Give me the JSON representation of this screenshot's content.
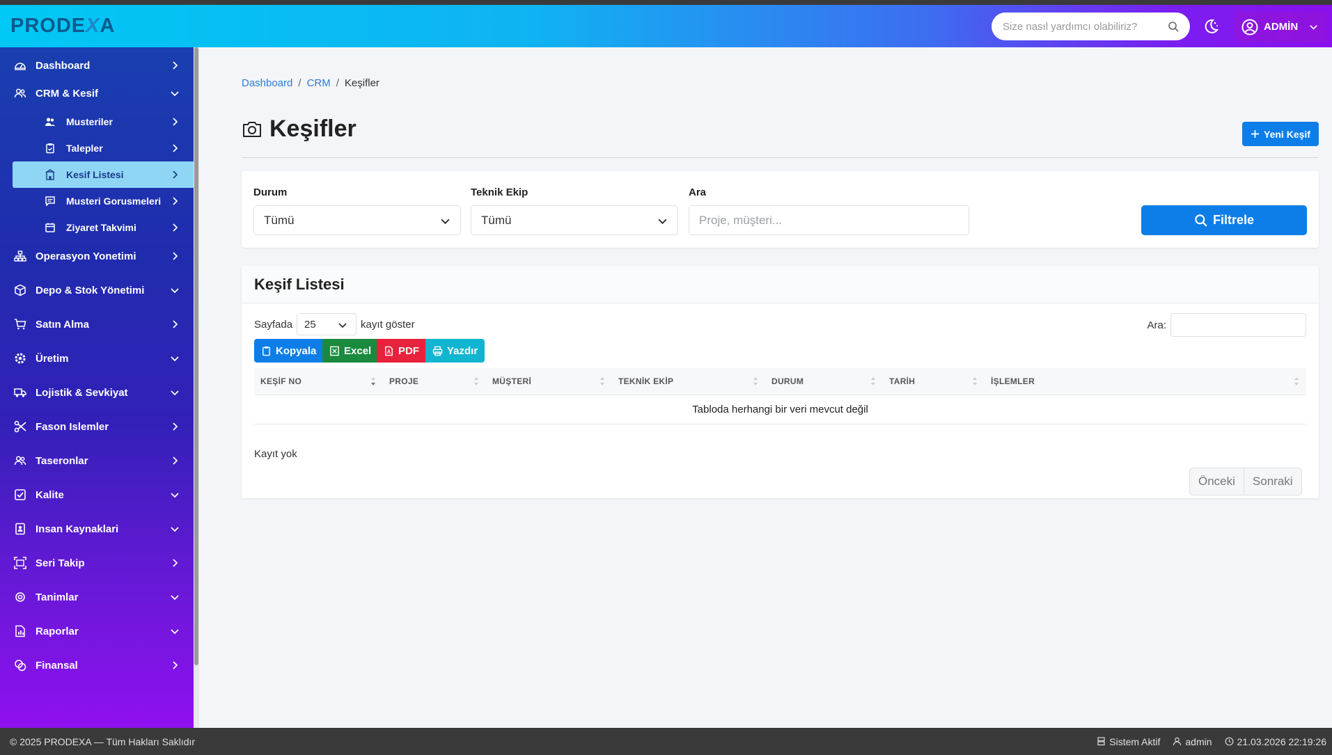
{
  "header": {
    "logo_pre": "PRODE",
    "logo_x": "X",
    "logo_post": "A",
    "search_placeholder": "Size nasıl yardımcı olabiliriz?",
    "user_label": "ADMİN"
  },
  "sidebar": {
    "items": [
      {
        "label": "Dashboard",
        "icon": "dashboard-icon"
      },
      {
        "label": "CRM & Kesif",
        "icon": "users-icon"
      },
      {
        "label": "Operasyon Yonetimi",
        "icon": "sitemap-icon"
      },
      {
        "label": "Depo & Stok Yönetimi",
        "icon": "box-icon"
      },
      {
        "label": "Satın Alma",
        "icon": "cart-icon"
      },
      {
        "label": "Üretim",
        "icon": "gear-icon"
      },
      {
        "label": "Lojistik & Sevkiyat",
        "icon": "truck-icon"
      },
      {
        "label": "Fason Islemler",
        "icon": "scissors-icon"
      },
      {
        "label": "Taseronlar",
        "icon": "users-icon"
      },
      {
        "label": "Kalite",
        "icon": "check-square-icon"
      },
      {
        "label": "Insan Kaynaklari",
        "icon": "id-badge-icon"
      },
      {
        "label": "Seri Takip",
        "icon": "scan-icon"
      },
      {
        "label": "Tanimlar",
        "icon": "cog-icon"
      },
      {
        "label": "Raporlar",
        "icon": "report-icon"
      },
      {
        "label": "Finansal",
        "icon": "coins-icon"
      }
    ],
    "sub_items": [
      {
        "label": "Musteriler",
        "icon": "user-group-icon"
      },
      {
        "label": "Talepler",
        "icon": "clipboard-icon"
      },
      {
        "label": "Kesif Listesi",
        "icon": "building-icon"
      },
      {
        "label": "Musteri Gorusmeleri",
        "icon": "chat-icon"
      },
      {
        "label": "Ziyaret Takvimi",
        "icon": "calendar-icon"
      }
    ]
  },
  "breadcrumb": [
    "Dashboard",
    "CRM",
    "Keşifler"
  ],
  "page": {
    "title": "Keşifler",
    "new_button": "Yeni Keşif"
  },
  "filters": {
    "status_label": "Durum",
    "status_value": "Tümü",
    "team_label": "Teknik Ekip",
    "team_value": "Tümü",
    "search_label": "Ara",
    "search_placeholder": "Proje, müşteri...",
    "filter_button": "Filtrele"
  },
  "list": {
    "title": "Keşif Listesi",
    "length_prefix": "Sayfada",
    "length_value": "25",
    "length_suffix": "kayıt göster",
    "search_label": "Ara:",
    "export": {
      "copy": "Kopyala",
      "excel": "Excel",
      "pdf": "PDF",
      "print": "Yazdır"
    },
    "columns": [
      "KEŞİF NO",
      "PROJE",
      "MÜŞTERİ",
      "TEKNİK EKİP",
      "DURUM",
      "TARİH",
      "İŞLEMLER"
    ],
    "empty_message": "Tabloda herhangi bir veri mevcut değil",
    "info": "Kayıt yok",
    "prev": "Önceki",
    "next": "Sonraki"
  },
  "footer": {
    "copyright": "© 2025 PRODEXA — Tüm Hakları Saklıdır",
    "status": "Sistem Aktif",
    "user": "admin",
    "datetime": "21.03.2026 22:19:26"
  },
  "colors": {
    "primary": "#0d7ee8",
    "excel": "#1a8a3e",
    "pdf": "#e8213c",
    "print": "#12b5d0",
    "active_sub": "#8fd6f5"
  }
}
